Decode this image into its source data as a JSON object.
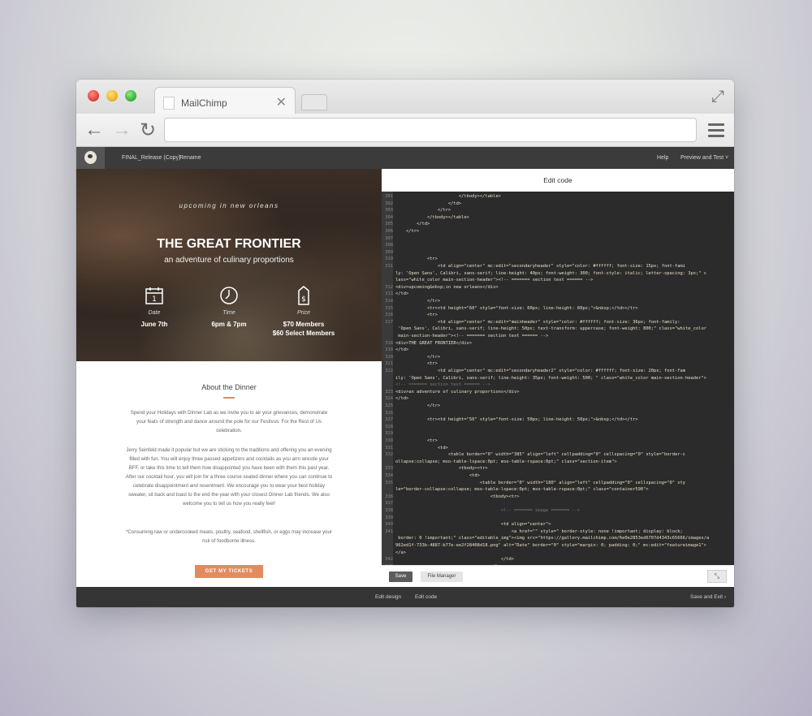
{
  "browser": {
    "tab_title": "MailChimp",
    "tab_close": "✕",
    "expand_icon": "⤢"
  },
  "appbar": {
    "file_name": "FINAL_Release (Copy)",
    "rename": "Rename",
    "help": "Help",
    "preview": "Preview and Test ˅"
  },
  "hero": {
    "kicker": "upcoming in new orleans",
    "title": "THE GREAT FRONTIER",
    "subtitle": "an adventure of culinary proportions",
    "columns": [
      {
        "icon": "calendar-icon",
        "glyph": "1",
        "label": "Date",
        "value_1": "June 7th",
        "value_2": ""
      },
      {
        "icon": "clock-icon",
        "glyph": "◷",
        "label": "Time",
        "value_1": "6pm & 7pm",
        "value_2": ""
      },
      {
        "icon": "price-tag-icon",
        "glyph": "$",
        "label": "Price",
        "value_1": "$70 Members",
        "value_2": "$60 Select Members"
      }
    ]
  },
  "about": {
    "heading": "About the Dinner",
    "p1": "Spend your Holidays with Dinner Lab as we invite you to air your grievances, demonstrate your feats of strength and dance around the pole for our Festivus: For the Rest of Us celebration.",
    "p2": "Jerry Seinfeld made it popular but we are sticking to the traditions and offering you an evening filled with fun. You will enjoy three passed appetizers and cocktails as you arm wrestle your BFF, or take this time to tell them how disappointed you have been with them this past year. After our cocktail hour, you will join for a three course seated dinner where you can continue to celebrate disappointment and resentment. We encourage you to wear your best holiday sweater, sit back and toast to the end the year with your closest Dinner Lab friends. We also welcome you to tell us how you really feel!",
    "p3": "*Consuming raw or undercooked meats, poultry, seafood, shellfish, or eggs may increase your risk of foodborne illness.",
    "button": "GET MY TICKETS"
  },
  "editor": {
    "title": "Edit code",
    "lines": [
      {
        "n": "301",
        "t": "                        </tbody></table>"
      },
      {
        "n": "302",
        "t": "                    </td>"
      },
      {
        "n": "303",
        "t": "                </tr>"
      },
      {
        "n": "304",
        "t": "            </tbody></table>"
      },
      {
        "n": "305",
        "t": "        </td>"
      },
      {
        "n": "306",
        "t": "    </tr>"
      },
      {
        "n": "307",
        "t": ""
      },
      {
        "n": "308",
        "t": ""
      },
      {
        "n": "309",
        "t": ""
      },
      {
        "n": "310",
        "t": "            <tr>"
      },
      {
        "n": "311",
        "t": "                <td align=\"center\" mc:edit=\"secondaryheader\" style=\"color: #ffffff; font-size: 15px; font-fami"
      },
      {
        "n": "",
        "t": "ly: 'Open Sans', Calibri, sans-serif; line-height: 40px; font-weight: 300; font-style: italic; letter-spacing: 3px;\" c"
      },
      {
        "n": "",
        "t": "lass=\"white_color main-section-header\"><!-- ======= section text ====== -->"
      },
      {
        "n": "312",
        "t": "<div>upcoming&nbsp;in new orleans</div>"
      },
      {
        "n": "313",
        "t": "</td>"
      },
      {
        "n": "314",
        "t": "            </tr>"
      },
      {
        "n": "315",
        "t": "            <tr><td height=\"60\" style=\"font-size: 60px; line-height: 60px;\">&nbsp;</td></tr>"
      },
      {
        "n": "316",
        "t": "            <tr>"
      },
      {
        "n": "317",
        "t": "                <td align=\"center\" mc:edit=\"mainheader\" style=\"color: #ffffff; font-size: 36px; font-family:"
      },
      {
        "n": "",
        "t": " 'Open Sans', Calibri, sans-serif; line-height: 50px; text-transform: uppercase; font-weight: 800;\" class=\"white_color"
      },
      {
        "n": "",
        "t": " main-section-header\"><!-- ======= section text ====== -->"
      },
      {
        "n": "318",
        "t": "<div>THE GREAT FRONTIER</div>"
      },
      {
        "n": "319",
        "t": "</td>"
      },
      {
        "n": "320",
        "t": "            </tr>"
      },
      {
        "n": "321",
        "t": "            <tr>"
      },
      {
        "n": "322",
        "t": "                <td align=\"center\" mc:edit=\"secondaryheader2\" style=\"color: #ffffff; font-size: 20px; font-fam"
      },
      {
        "n": "",
        "t": "ily: 'Open Sans', Calibri, sans-serif; line-height: 35px; font-weight: 500; \" class=\"white_color main-section-header\">"
      },
      {
        "n": "",
        "t": "<!-- ======= section text ====== -->"
      },
      {
        "n": "323",
        "t": "<div>an adventure of culinary proportions</div>"
      },
      {
        "n": "324",
        "t": "</td>"
      },
      {
        "n": "325",
        "t": "            </tr>"
      },
      {
        "n": "326",
        "t": ""
      },
      {
        "n": "327",
        "t": "            <tr><td height=\"50\" style=\"font-size: 50px; line-height: 50px;\">&nbsp;</td></tr>"
      },
      {
        "n": "328",
        "t": ""
      },
      {
        "n": "329",
        "t": ""
      },
      {
        "n": "330",
        "t": "            <tr>"
      },
      {
        "n": "331",
        "t": "                <td>"
      },
      {
        "n": "332",
        "t": "                    <table border=\"0\" width=\"385\" align=\"left\" cellpadding=\"0\" cellspacing=\"0\" style=\"border-c"
      },
      {
        "n": "",
        "t": "ollapse:collapse; mso-table-lspace:0pt; mso-table-rspace:0pt;\" class=\"section-item\">"
      },
      {
        "n": "333",
        "t": "                        <tbody><tr>"
      },
      {
        "n": "334",
        "t": "                            <td>"
      },
      {
        "n": "335",
        "t": "                                <table border=\"0\" width=\"180\" align=\"left\" cellpadding=\"0\" cellspacing=\"0\" sty"
      },
      {
        "n": "",
        "t": "le=\"border-collapse:collapse; mso-table-lspace:0pt; mso-table-rspace:0pt;\" class=\"container590\">"
      },
      {
        "n": "336",
        "t": "                                    <tbody><tr>"
      },
      {
        "n": "337",
        "t": ""
      },
      {
        "n": "338",
        "t": "                                        <!-- ======= image ======= -->"
      },
      {
        "n": "339",
        "t": ""
      },
      {
        "n": "340",
        "t": "                                        <td align=\"center\">"
      },
      {
        "n": "341",
        "t": "                                            <a href=\"\" style=\" border-style: none !important; display: block;"
      },
      {
        "n": "",
        "t": " border: 0 !important;\" class=\"editable_img\"><img src=\"https://gallery.mailchimp.com/6e0e2853ed6707d4343c65666/images/a"
      },
      {
        "n": "",
        "t": "962ed1f-733b-4887-b77e-ee2f28408d18.png\" alt=\"Date\" border=\"0\" style=\"margin: 0; padding: 0;\" mc:edit=\"featureimage1\">"
      },
      {
        "n": "",
        "t": "</a>"
      },
      {
        "n": "342",
        "t": "                                        </td>"
      },
      {
        "n": "343",
        "t": "                                    </tr>"
      }
    ],
    "save": "Save",
    "file_manager": "File Manager",
    "fullscreen_glyph": "⤡"
  },
  "bottombar": {
    "edit_design": "Edit design",
    "edit_code": "Edit code",
    "save_exit": "Save and Exit ›"
  },
  "colors": {
    "accent": "#e38b5f",
    "appbar_bg": "#3b3b3b",
    "code_bg": "#2b2b2b",
    "code_text": "#e6dfc7"
  }
}
